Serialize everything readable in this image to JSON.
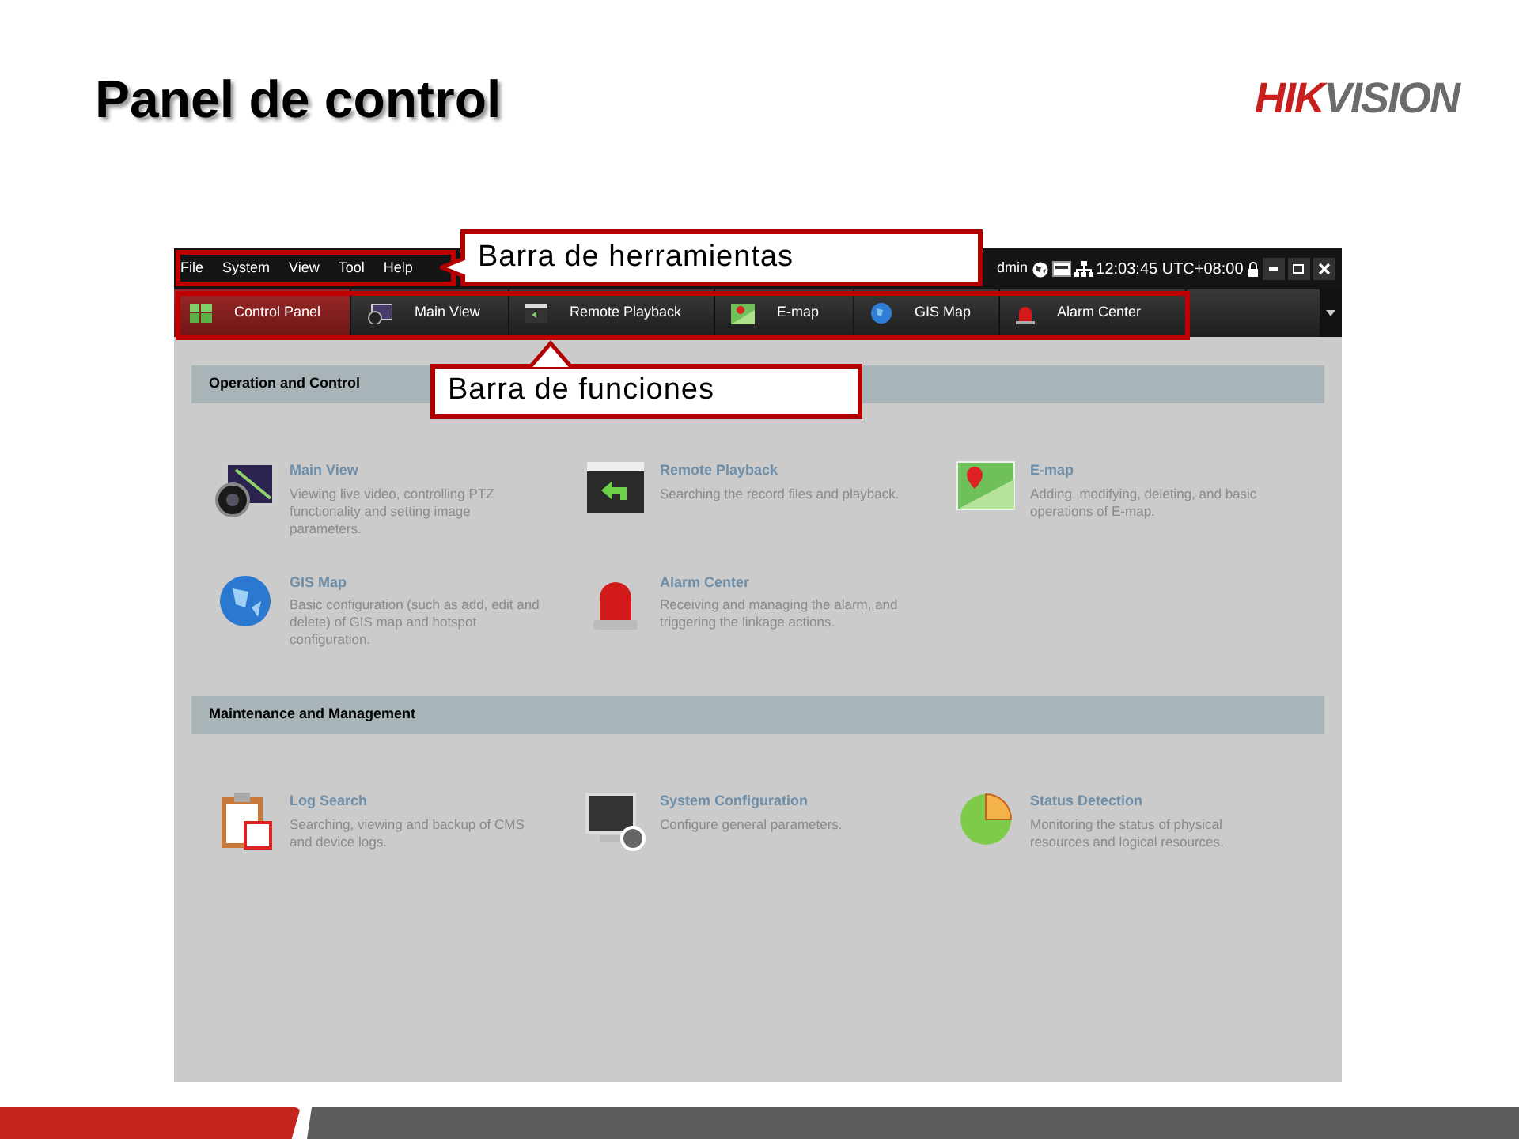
{
  "slide": {
    "title": "Panel de control",
    "logo": {
      "part_1": "HIK",
      "part_2": "VISION"
    }
  },
  "app": {
    "menu": [
      "File",
      "System",
      "View",
      "Tool",
      "Help"
    ],
    "status": {
      "user": "dmin",
      "clock": "12:03:45 UTC+08:00"
    },
    "tabs": [
      {
        "label": "Control Panel",
        "selected": true
      },
      {
        "label": "Main View",
        "selected": false
      },
      {
        "label": "Remote Playback",
        "selected": false
      },
      {
        "label": "E-map",
        "selected": false
      },
      {
        "label": "GIS Map",
        "selected": false
      },
      {
        "label": "Alarm Center",
        "selected": false
      }
    ],
    "sections": [
      {
        "title": "Operation and Control",
        "items": [
          {
            "title": "Main View",
            "description": "Viewing live video, controlling PTZ functionality and setting image parameters."
          },
          {
            "title": "Remote Playback",
            "description": "Searching the record files and playback."
          },
          {
            "title": "E-map",
            "description": "Adding, modifying, deleting, and basic operations of E-map."
          },
          {
            "title": "GIS Map",
            "description": "Basic configuration (such as add, edit and delete) of GIS map and hotspot configuration."
          },
          {
            "title": "Alarm Center",
            "description": "Receiving and managing the alarm, and triggering the linkage actions."
          }
        ]
      },
      {
        "title": "Maintenance and Management",
        "items": [
          {
            "title": "Log Search",
            "description": "Searching, viewing and backup of CMS and device logs."
          },
          {
            "title": "System Configuration",
            "description": "Configure general parameters."
          },
          {
            "title": "Status Detection",
            "description": "Monitoring the status of physical resources and logical resources."
          }
        ]
      }
    ]
  },
  "callouts": [
    {
      "text": "Barra de herramientas"
    },
    {
      "text": "Barra de funciones"
    }
  ]
}
